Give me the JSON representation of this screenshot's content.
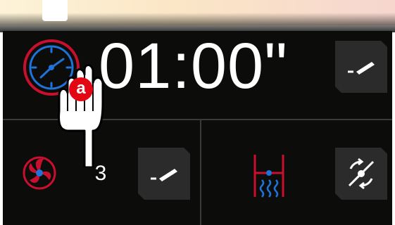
{
  "timer": {
    "value": "01:00\""
  },
  "fan": {
    "level": "3"
  },
  "annotation": {
    "badge": "a"
  },
  "icons": {
    "clock": "clock-icon",
    "fan": "fan-icon",
    "edit": "pencil-icon",
    "heat": "heating-element-icon",
    "rotate": "rotate-icon",
    "hand": "pointing-hand-icon"
  },
  "colors": {
    "accent_red": "#c8102e",
    "accent_blue": "#1e73d8",
    "background": "#0c0c0a",
    "button": "#2b2b2b"
  }
}
